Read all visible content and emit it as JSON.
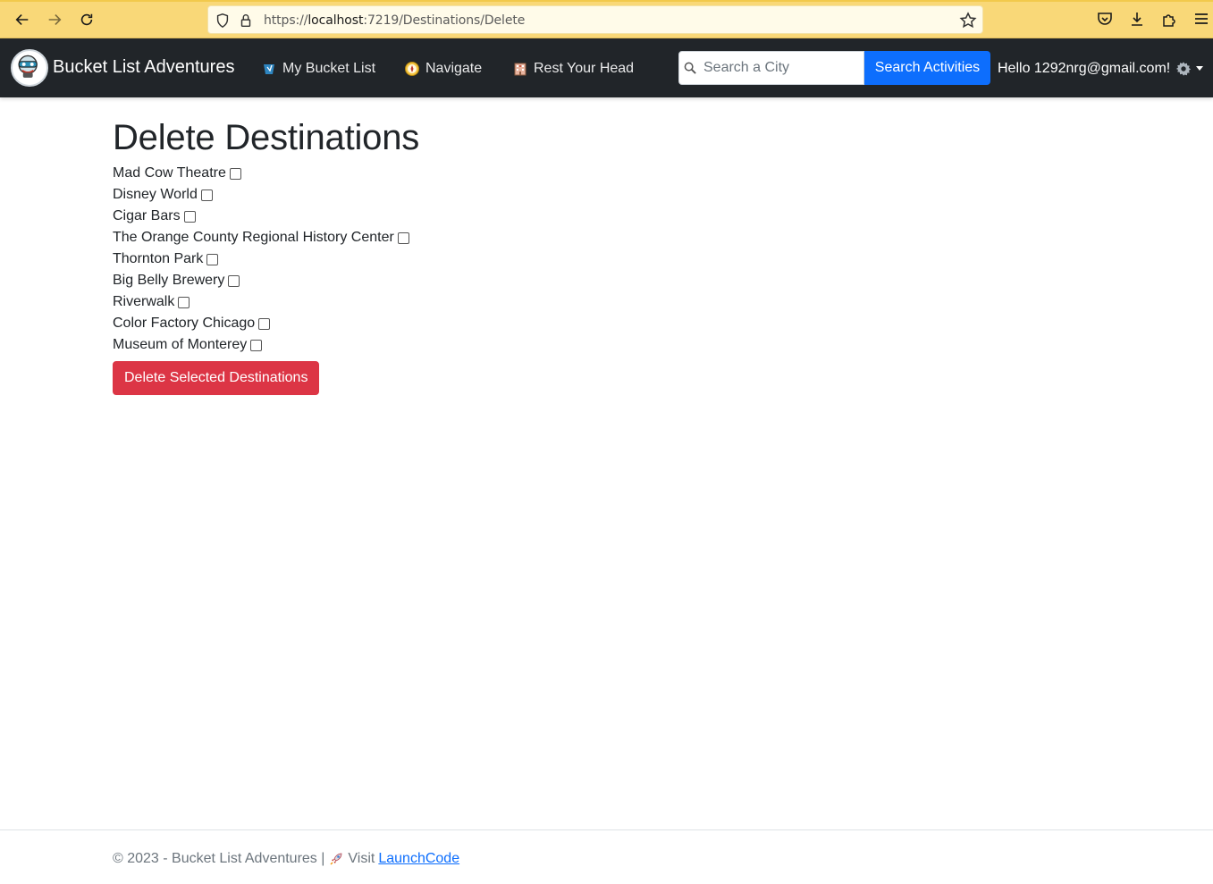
{
  "browser": {
    "url_prefix": "https://",
    "url_host": "localhost",
    "url_rest": ":7219/Destinations/Delete"
  },
  "navbar": {
    "brand": "Bucket List Adventures",
    "items": [
      {
        "label": "My Bucket List",
        "icon": "bucket-list-icon"
      },
      {
        "label": "Navigate",
        "icon": "compass-icon"
      },
      {
        "label": "Rest Your Head",
        "icon": "hotel-icon"
      }
    ],
    "search_placeholder": "Search a City",
    "search_button": "Search Activities",
    "greeting": "Hello 1292nrg@gmail.com!"
  },
  "main": {
    "title": "Delete Destinations",
    "destinations": [
      "Mad Cow Theatre",
      "Disney World",
      "Cigar Bars",
      "The Orange County Regional History Center",
      "Thornton Park",
      "Big Belly Brewery",
      "Riverwalk",
      "Color Factory Chicago",
      "Museum of Monterey"
    ],
    "delete_button": "Delete Selected Destinations"
  },
  "footer": {
    "text": "© 2023 - Bucket List Adventures |",
    "visit": "Visit",
    "link": "LaunchCode"
  },
  "colors": {
    "browser_bar": "#f9d878",
    "navbar": "#212529",
    "primary": "#0d6efd",
    "danger": "#dc3545"
  }
}
